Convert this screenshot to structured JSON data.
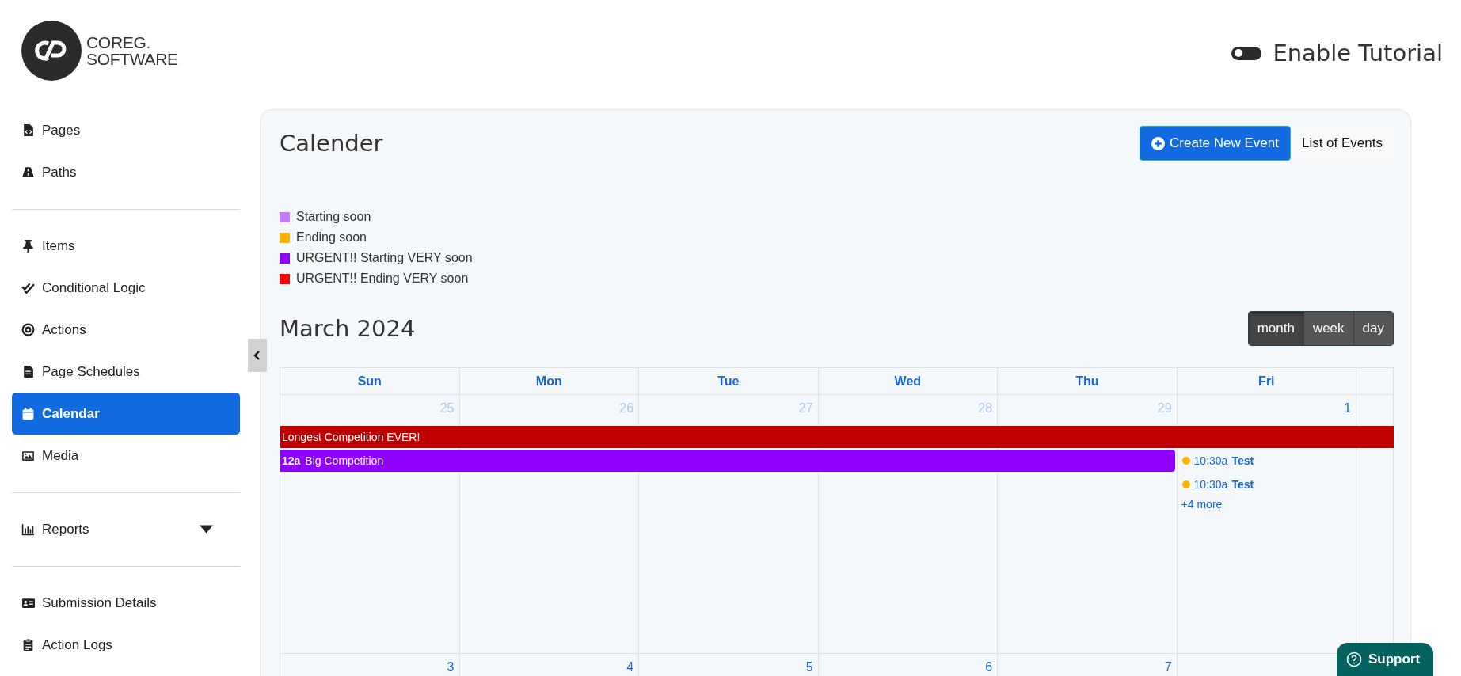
{
  "logo": {
    "name_line1": "COREG.",
    "name_line2": "SOFTWARE"
  },
  "tutorial": {
    "label": "Enable Tutorial",
    "on": false
  },
  "sidebar": {
    "groups": [
      {
        "items": [
          {
            "label": "Pages",
            "selected": false
          },
          {
            "label": "Paths",
            "selected": false
          }
        ]
      },
      {
        "items": [
          {
            "label": "Items",
            "selected": false
          },
          {
            "label": "Conditional Logic",
            "selected": false
          },
          {
            "label": "Actions",
            "selected": false
          },
          {
            "label": "Page Schedules",
            "selected": false
          },
          {
            "label": "Calendar",
            "selected": true
          },
          {
            "label": "Media",
            "selected": false
          }
        ]
      },
      {
        "items": [
          {
            "label": "Reports",
            "selected": false,
            "expandable": true
          }
        ]
      },
      {
        "items": [
          {
            "label": "Submission Details",
            "selected": false
          },
          {
            "label": "Action Logs",
            "selected": false
          }
        ]
      }
    ]
  },
  "page": {
    "title": "Calender",
    "buttons": [
      {
        "label": "Create New Event",
        "kind": "primary"
      },
      {
        "label": "List of Events",
        "kind": "plain"
      }
    ]
  },
  "legend": [
    {
      "label": "Starting soon",
      "color": "#c77dff"
    },
    {
      "label": "Ending soon",
      "color": "#ffb300"
    },
    {
      "label": "URGENT!! Starting VERY soon",
      "color": "#8f00ff"
    },
    {
      "label": "URGENT!! Ending VERY soon",
      "color": "#ff0000"
    }
  ],
  "calendar": {
    "title": "March 2024",
    "views": [
      {
        "label": "month",
        "selected": true
      },
      {
        "label": "week",
        "selected": false
      },
      {
        "label": "day",
        "selected": false
      }
    ],
    "headers": [
      "Sun",
      "Mon",
      "Tue",
      "Wed",
      "Thu",
      "Fri"
    ],
    "weeks": [
      {
        "days": [
          {
            "date": "25",
            "other_month": true
          },
          {
            "date": "26",
            "other_month": true
          },
          {
            "date": "27",
            "other_month": true
          },
          {
            "date": "28",
            "other_month": true
          },
          {
            "date": "29",
            "other_month": true
          },
          {
            "date": "1",
            "other_month": false,
            "events": [
              {
                "time": "10:30a",
                "title": "Test",
                "color": "#ffb300"
              },
              {
                "time": "10:30a",
                "title": "Test",
                "color": "#ffb300"
              }
            ],
            "more": "+4 more"
          }
        ],
        "bars": [
          {
            "title": "Longest Competition EVER!",
            "color": "#c00000",
            "covers": [
              true,
              true,
              true,
              true,
              true,
              true,
              true
            ]
          },
          {
            "time": "12a",
            "title": "Big Competition",
            "color": "#8f00ff",
            "covers": [
              true,
              true,
              true,
              true,
              true,
              false,
              false
            ]
          }
        ]
      },
      {
        "days": [
          {
            "date": "3",
            "other_month": false
          },
          {
            "date": "4",
            "other_month": false
          },
          {
            "date": "5",
            "other_month": false
          },
          {
            "date": "6",
            "other_month": false
          },
          {
            "date": "7",
            "other_month": false
          }
        ]
      }
    ]
  },
  "support": {
    "label": "Support"
  }
}
